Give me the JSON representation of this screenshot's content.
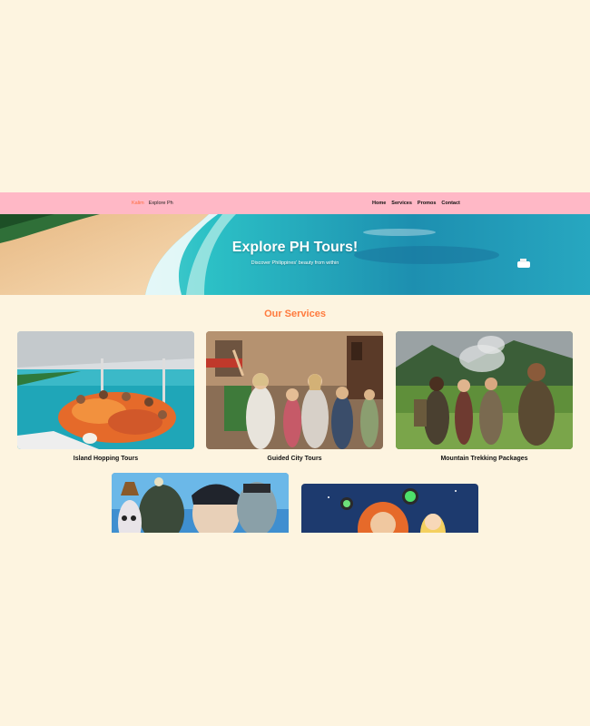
{
  "navbar": {
    "logo_text": "Kalim",
    "brand_name": "Explore Ph",
    "links": [
      "Home",
      "Services",
      "Promos",
      "Contact"
    ]
  },
  "hero": {
    "title": "Explore PH Tours!",
    "subtitle": "Discover Philippines' beauty from within"
  },
  "services": {
    "heading": "Our Services",
    "cards": [
      {
        "title": "Island Hopping Tours",
        "image": "boat-tour-photo"
      },
      {
        "title": "Guided City Tours",
        "image": "city-tour-photo"
      },
      {
        "title": "Mountain Trekking Packages",
        "image": "jungle-adventure-photo"
      },
      {
        "title": "",
        "image": "animated-monsters-poster"
      },
      {
        "title": "",
        "image": "space-cartoon-poster"
      }
    ]
  },
  "colors": {
    "page_bg": "#fdf4e0",
    "navbar_bg": "#ffb8c6",
    "accent": "#ff7a3d"
  }
}
